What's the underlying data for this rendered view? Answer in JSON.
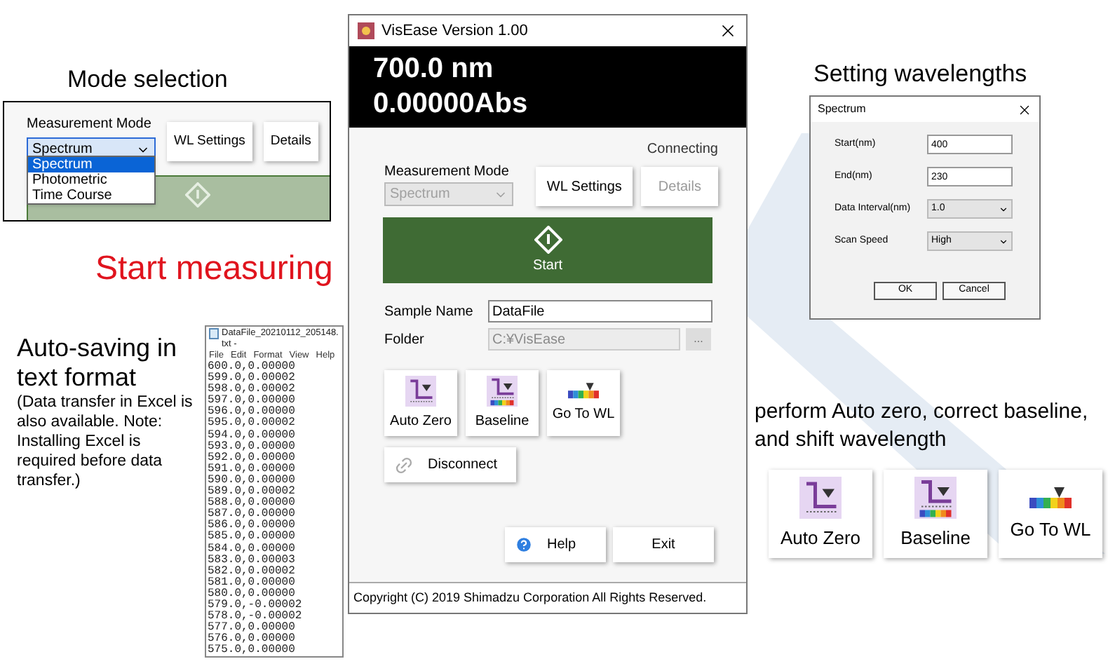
{
  "mode_callout": {
    "caption": "Mode selection",
    "label": "Measurement Mode",
    "select": {
      "value": "Spectrum",
      "expanded": true
    },
    "options": [
      {
        "label": "Spectrum",
        "selected": true
      },
      {
        "label": "Photometric",
        "selected": false
      },
      {
        "label": "Time Course",
        "selected": false
      }
    ],
    "buttons": [
      {
        "label": "WL Settings",
        "disabled": false
      },
      {
        "label": "Details",
        "disabled": false
      }
    ]
  },
  "start_caption": "Start measuring",
  "autosave": {
    "title": "Auto-saving in text format",
    "note": "(Data transfer in Excel is also available. Note: Installing Excel is required before data transfer.)"
  },
  "notepad": {
    "title": "DataFile_20210112_205148.txt -",
    "menu": [
      "File",
      "Edit",
      "Format",
      "View",
      "Help"
    ],
    "lines": [
      "600.0,0.00000",
      "599.0,0.00002",
      "598.0,0.00002",
      "597.0,0.00000",
      "596.0,0.00000",
      "595.0,0.00002",
      "594.0,0.00000",
      "593.0,0.00000",
      "592.0,0.00000",
      "591.0,0.00000",
      "590.0,0.00000",
      "589.0,0.00002",
      "588.0,0.00000",
      "587.0,0.00000",
      "586.0,0.00000",
      "585.0,0.00000",
      "584.0,0.00000",
      "583.0,0.00003",
      "582.0,0.00002",
      "581.0,0.00000",
      "580.0,0.00000",
      "579.0,-0.00002",
      "578.0,-0.00002",
      "577.0,0.00000",
      "576.0,0.00000",
      "575.0,0.00000"
    ]
  },
  "main_window": {
    "title": "VisEase Version 1.00",
    "wavelength": "700.0 nm",
    "absorbance": "0.00000Abs",
    "status": "Connecting",
    "mode_label": "Measurement Mode",
    "mode_select": {
      "value": "Spectrum",
      "disabled": true
    },
    "top_buttons": [
      {
        "label": "WL Settings",
        "disabled": false
      },
      {
        "label": "Details",
        "disabled": true
      }
    ],
    "start": "Start",
    "fields": [
      {
        "label": "Sample Name",
        "value": "DataFile",
        "disabled": false
      },
      {
        "label": "Folder",
        "value": "C:¥VisEase",
        "disabled": true,
        "browse": "..."
      }
    ],
    "tools": [
      {
        "kind": "auto_zero",
        "label": "Auto Zero"
      },
      {
        "kind": "baseline",
        "label": "Baseline"
      },
      {
        "kind": "go_to_wl",
        "label": "Go To WL"
      }
    ],
    "disconnect": "Disconnect",
    "help": "Help",
    "exit": "Exit",
    "copyright": "Copyright (C) 2019 Shimadzu Corporation All Rights Reserved."
  },
  "wavelength_callout": {
    "caption": "Setting wavelengths",
    "dialog": {
      "title": "Spectrum",
      "rows": [
        {
          "kind": "input",
          "label": "Start(nm)",
          "value": "400"
        },
        {
          "kind": "input",
          "label": "End(nm)",
          "value": "230"
        },
        {
          "kind": "select",
          "label": "Data Interval(nm)",
          "value": "1.0"
        },
        {
          "kind": "select",
          "label": "Scan Speed",
          "value": "High"
        }
      ],
      "buttons": [
        "OK",
        "Cancel"
      ]
    }
  },
  "tools_callout": {
    "caption": "perform Auto zero, correct baseline, and shift wavelength",
    "tools": [
      {
        "kind": "auto_zero",
        "label": "Auto Zero"
      },
      {
        "kind": "baseline",
        "label": "Baseline"
      },
      {
        "kind": "go_to_wl",
        "label": "Go To WL"
      }
    ]
  }
}
